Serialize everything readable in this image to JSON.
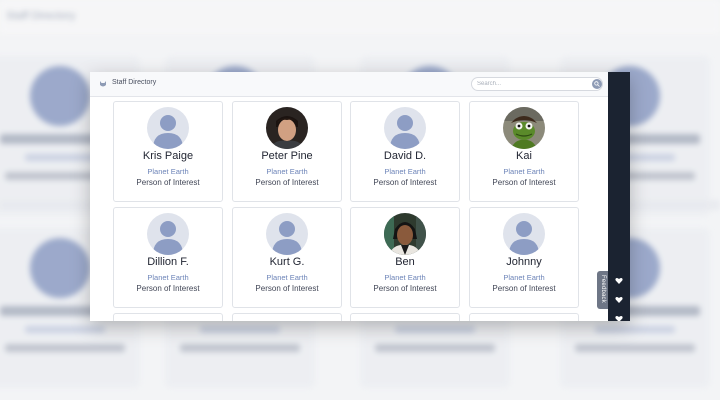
{
  "header": {
    "title": "Staff Directory"
  },
  "search": {
    "placeholder": "Search...",
    "value": ""
  },
  "feedback": {
    "label": "Feedback"
  },
  "cards": [
    {
      "name": "Kris Paige",
      "location": "Planet Earth",
      "role": "Person of Interest",
      "avatar": "default-avatar"
    },
    {
      "name": "Peter Pine",
      "location": "Planet Earth",
      "role": "Person of Interest",
      "avatar": "photo"
    },
    {
      "name": "David D.",
      "location": "Planet Earth",
      "role": "Person of Interest",
      "avatar": "default-avatar"
    },
    {
      "name": "Kai",
      "location": "Planet Earth",
      "role": "Person of Interest",
      "avatar": "photo"
    },
    {
      "name": "Dillion F.",
      "location": "Planet Earth",
      "role": "Person of Interest",
      "avatar": "default-avatar"
    },
    {
      "name": "Kurt G.",
      "location": "Planet Earth",
      "role": "Person of Interest",
      "avatar": "default-avatar"
    },
    {
      "name": "Ben",
      "location": "Planet Earth",
      "role": "Person of Interest",
      "avatar": "photo"
    },
    {
      "name": "Johnny",
      "location": "Planet Earth",
      "role": "Person of Interest",
      "avatar": "default-avatar"
    }
  ],
  "colors": {
    "accent": "#6d84b8",
    "sidebar": "#1b2331",
    "avatar": "#8d9dc4"
  }
}
